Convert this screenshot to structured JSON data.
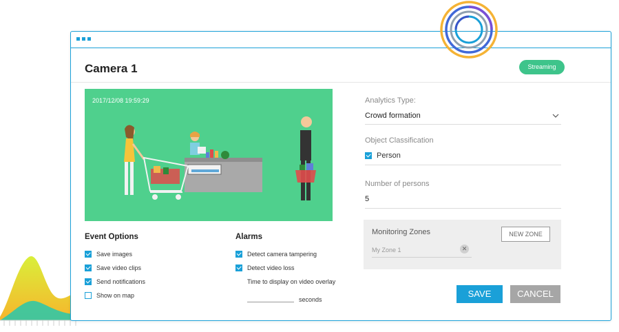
{
  "window": {
    "title": "Camera 1",
    "status_badge": "Streaming"
  },
  "video": {
    "timestamp": "2017/12/08  19:59:29"
  },
  "event_options": {
    "title": "Event Options",
    "items": [
      {
        "label": "Save images",
        "checked": true
      },
      {
        "label": "Save video clips",
        "checked": true
      },
      {
        "label": "Send notifications",
        "checked": true
      },
      {
        "label": "Show on map",
        "checked": false
      }
    ]
  },
  "alarms": {
    "title": "Alarms",
    "items": [
      {
        "label": "Detect camera tampering",
        "checked": true
      },
      {
        "label": "Detect video loss",
        "checked": true
      }
    ],
    "overlay_label": "Time to display on video overlay",
    "overlay_value": "",
    "overlay_unit": "seconds"
  },
  "analytics": {
    "type_label": "Analytics Type:",
    "type_value": "Crowd formation",
    "classification_label": "Object Classification",
    "classification_items": [
      {
        "label": "Person",
        "checked": true
      }
    ],
    "persons_label": "Number of persons",
    "persons_value": "5"
  },
  "zones": {
    "title": "Monitoring Zones",
    "new_button": "NEW ZONE",
    "items": [
      {
        "name": "My Zone 1"
      }
    ]
  },
  "actions": {
    "save": "SAVE",
    "cancel": "CANCEL"
  },
  "icons": {
    "window_menu": "window-dots-icon",
    "dropdown": "chevron-down-icon",
    "remove_zone": "close-icon",
    "checkbox": "checkmark-icon"
  },
  "colors": {
    "accent": "#1aa0d8",
    "streaming": "#3ec48b",
    "video_bg": "#4fd08d",
    "cancel": "#a6a6a6"
  }
}
